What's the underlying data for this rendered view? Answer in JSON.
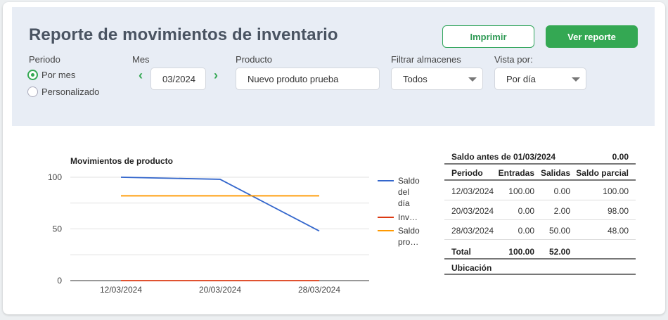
{
  "header": {
    "title": "Reporte de movimientos de inventario",
    "print_label": "Imprimir",
    "view_report_label": "Ver reporte"
  },
  "filters": {
    "periodo_label": "Periodo",
    "por_mes_label": "Por mes",
    "personalizado_label": "Personalizado",
    "mes_label": "Mes",
    "mes_value": "03/2024",
    "producto_label": "Producto",
    "producto_value": "Nuevo produto prueba",
    "almacenes_label": "Filtrar almacenes",
    "almacenes_value": "Todos",
    "vista_label": "Vista por:",
    "vista_value": "Por día"
  },
  "chart_data": {
    "type": "line",
    "title": "Movimientos de producto",
    "categories": [
      "12/03/2024",
      "20/03/2024",
      "28/03/2024"
    ],
    "series": [
      {
        "name": "Saldo del día",
        "legend_lines": [
          "Saldo",
          "del",
          "día"
        ],
        "color": "#3366cc",
        "values": [
          100,
          98,
          48
        ]
      },
      {
        "name": "Inv…",
        "legend_lines": [
          "Inv…"
        ],
        "color": "#dc3912",
        "values": [
          0,
          0,
          0
        ]
      },
      {
        "name": "Saldo pro…",
        "legend_lines": [
          "Saldo",
          "pro…"
        ],
        "color": "#ff9900",
        "values": [
          82,
          82,
          82
        ]
      }
    ],
    "y_ticks": [
      "100",
      "50",
      "0"
    ],
    "ylim": [
      0,
      100
    ],
    "grid": true,
    "legend_position": "right"
  },
  "table": {
    "saldo_antes_label": "Saldo antes de 01/03/2024",
    "saldo_antes_value": "0.00",
    "columns": [
      "Periodo",
      "Entradas",
      "Salidas",
      "Saldo parcial"
    ],
    "rows": [
      [
        "12/03/2024",
        "100.00",
        "0.00",
        "100.00"
      ],
      [
        "20/03/2024",
        "0.00",
        "2.00",
        "98.00"
      ],
      [
        "28/03/2024",
        "0.00",
        "50.00",
        "48.00"
      ]
    ],
    "total_label": "Total",
    "total_entradas": "100.00",
    "total_salidas": "52.00",
    "ubicacion_label": "Ubicación"
  }
}
